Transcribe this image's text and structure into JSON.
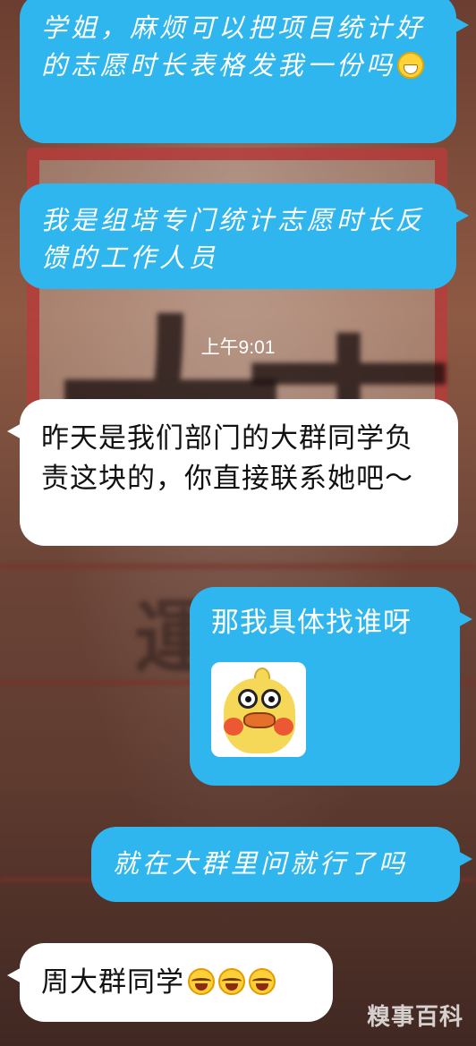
{
  "chat": {
    "messages": [
      {
        "side": "right",
        "text": "学姐，麻烦可以把项目统计好的志愿时长表格发我一份吗"
      },
      {
        "side": "right",
        "text": "我是组培专门统计志愿时长反馈的工作人员"
      },
      {
        "side": "left",
        "text": "昨天是我们部门的大群同学负责这块的，你直接联系她吧～"
      },
      {
        "side": "right",
        "text": "那我具体找谁呀"
      },
      {
        "side": "right",
        "text": "就在大群里问就行了吗"
      },
      {
        "side": "left",
        "text": "周大群同学"
      }
    ],
    "timestamp": "上午9:01"
  },
  "icons": {
    "grin": "grinning-face-icon",
    "joy": "tears-of-joy-icon",
    "sticker": "duck-sticker"
  },
  "colors": {
    "outgoing_bubble": "#2fb6ef",
    "incoming_bubble": "#ffffff"
  },
  "watermark": "糗事百科"
}
